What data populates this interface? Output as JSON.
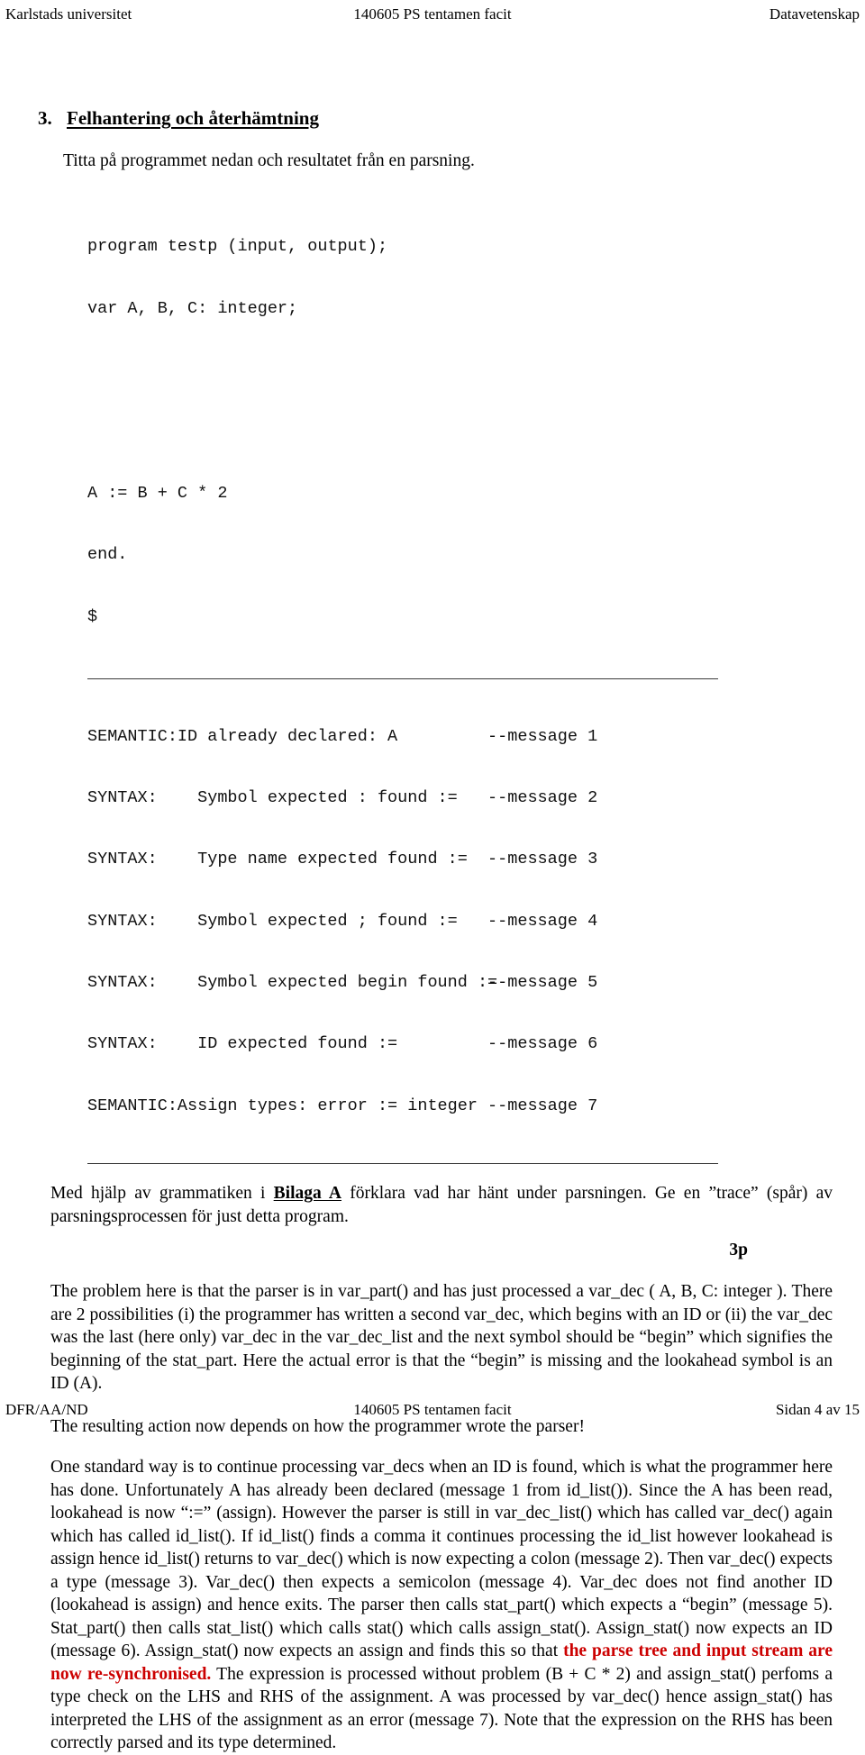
{
  "running_head": {
    "left": "Karlstads universitet",
    "center": "140605 PS tentamen facit",
    "right": "Datavetenskap"
  },
  "section": {
    "number": "3.",
    "title": "Felhantering och återhämtning",
    "lead": "Titta på programmet nedan och resultatet från en parsning."
  },
  "code": {
    "line1": "program testp (input, output);",
    "line2": "var A, B, C: integer;",
    "line3": "A := B + C * 2",
    "line4": "end.",
    "line5": "$"
  },
  "messages": [
    {
      "tag": "SEMANTIC:",
      "body": "ID already declared: A",
      "note": "--message 1"
    },
    {
      "tag": "SYNTAX:",
      "body": "  Symbol expected : found :=",
      "note": "--message 2"
    },
    {
      "tag": "SYNTAX:",
      "body": "  Type name expected found :=",
      "note": "--message 3"
    },
    {
      "tag": "SYNTAX:",
      "body": "  Symbol expected ; found :=",
      "note": "--message 4"
    },
    {
      "tag": "SYNTAX:",
      "body": "  Symbol expected begin found :=",
      "note": "--message 5"
    },
    {
      "tag": "SYNTAX:",
      "body": "  ID expected found :=",
      "note": "--message 6"
    },
    {
      "tag": "SEMANTIC:",
      "body": "Assign types: error := integer",
      "note": "--message 7"
    }
  ],
  "question": {
    "part1": "Med hjälp av grammatiken i ",
    "appendix": "Bilaga A",
    "part2": " förklara vad har hänt under parsningen. Ge en ”trace” (spår) av parsningsprocessen för just detta program.",
    "points": "3p"
  },
  "answer": {
    "para1": "The problem here is that the parser is in var_part() and has just processed a var_dec ( A, B, C: integer ). There are 2 possibilities (i) the programmer has written a second var_dec, which begins with an ID or (ii) the var_dec was the last (here only) var_dec in the var_dec_list and the next symbol should be “begin” which signifies the beginning of the stat_part. Here the actual error is that the “begin” is missing and the lookahead symbol is an ID (A).",
    "para2": "The resulting action now depends on how the programmer wrote the parser!",
    "para3_before": "One standard way is to continue processing var_decs when an ID is found, which is what the programmer here has done. Unfortunately A has already been declared (message 1 from id_list()). Since the A has been read, lookahead is now “:=” (assign). However the parser is still in var_dec_list() which has called var_dec() again which has called id_list(). If id_list() finds a comma it continues processing the id_list however lookahead is assign hence id_list() returns to var_dec() which is now expecting a colon (message 2). Then var_dec() expects a type (message 3). Var_dec() then expects a semicolon (message 4). Var_dec does not find another ID (lookahead is assign) and hence exits. The parser then calls stat_part() which expects a “begin” (message 5). Stat_part() then calls stat_list() which calls stat() which calls assign_stat(). Assign_stat() now expects an ID (message 6). Assign_stat() now expects an assign and finds this so that ",
    "para3_red": "the parse tree and input stream are now re-synchronised.",
    "para3_after": " The expression is processed without problem (B + C * 2) and assign_stat() perfoms a type check on the LHS and RHS of the assignment. A was processed by var_dec() hence assign_stat() has interpreted the LHS of the assignment as an error (message 7). Note that the expression on the RHS has been correctly parsed and its type determined."
  },
  "footer": {
    "left": "DFR/AA/ND",
    "center": "140605 PS tentamen facit",
    "right": "Sidan 4 av 15"
  },
  "colors": {
    "red_accent": "#cc0000",
    "rule": "#3a3a3a"
  }
}
